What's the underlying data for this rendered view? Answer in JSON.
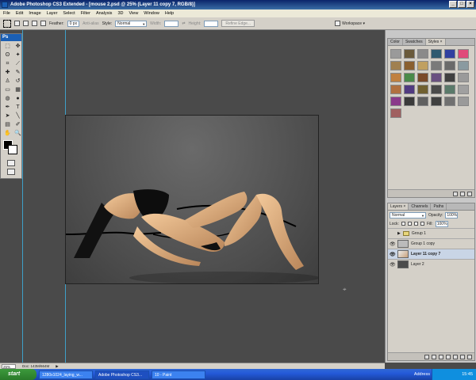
{
  "window": {
    "title": "Adobe Photoshop CS3 Extended - [mouse 2.psd @ 25% (Layer 11 copy 7, RGB/8)]"
  },
  "menu": [
    "File",
    "Edit",
    "Image",
    "Layer",
    "Select",
    "Filter",
    "Analysis",
    "3D",
    "View",
    "Window",
    "Help"
  ],
  "options": {
    "feather_label": "Feather:",
    "feather_value": "0 px",
    "antialias_label": "Anti-alias",
    "style_label": "Style:",
    "style_value": "Normal",
    "width_label": "Width:",
    "height_label": "Height:",
    "refine_label": "Refine Edge...",
    "workspace_label": "Workspace ▾"
  },
  "toolbox": {
    "header": "Ps"
  },
  "status": {
    "zoom": "25%",
    "doc": "Doc: 143M/664M"
  },
  "styles_panel": {
    "tabs": [
      "Color",
      "Swatches",
      "Styles ×"
    ],
    "swatch_colors": [
      "#9a9a9a",
      "#6a5a3a",
      "#8a8a8a",
      "#2f5a70",
      "#3040a0",
      "#e04a7a",
      "#a08050",
      "#8a6030",
      "#c0a060",
      "#7a7a7a",
      "#6a6a6a",
      "#8a9aa0",
      "#c08040",
      "#4a8a4a",
      "#7a4a2a",
      "#6a5080",
      "#404040",
      "#9a9a9a",
      "#b07040",
      "#503a80",
      "#706030",
      "#4a4a4a",
      "#5a7a6a",
      "#a0a0a0",
      "#8a3a8a",
      "#3a3a3a",
      "#606060",
      "#404040",
      "#707070",
      "#9a9a9a",
      "#a06060"
    ]
  },
  "layers_panel": {
    "tabs": [
      "Layers ×",
      "Channels",
      "Paths"
    ],
    "blend_mode": "Normal",
    "opacity_label": "Opacity:",
    "opacity_value": "100%",
    "lock_label": "Lock:",
    "fill_label": "Fill:",
    "fill_value": "100%",
    "layers": [
      {
        "name": "Group 1",
        "type": "group",
        "visible": false,
        "selected": false
      },
      {
        "name": "Group 1 copy",
        "type": "layer",
        "visible": true,
        "selected": false
      },
      {
        "name": "Layer 11 copy 7",
        "type": "layer",
        "visible": true,
        "selected": true
      },
      {
        "name": "Layer 2",
        "type": "layer",
        "visible": true,
        "selected": false
      }
    ]
  },
  "taskbar": {
    "start": "start",
    "tasks": [
      "1280x1024_laying_w...",
      "Adobe Photoshop CS3...",
      "10 - Paint"
    ],
    "address": "Address",
    "clock": "15:45"
  }
}
